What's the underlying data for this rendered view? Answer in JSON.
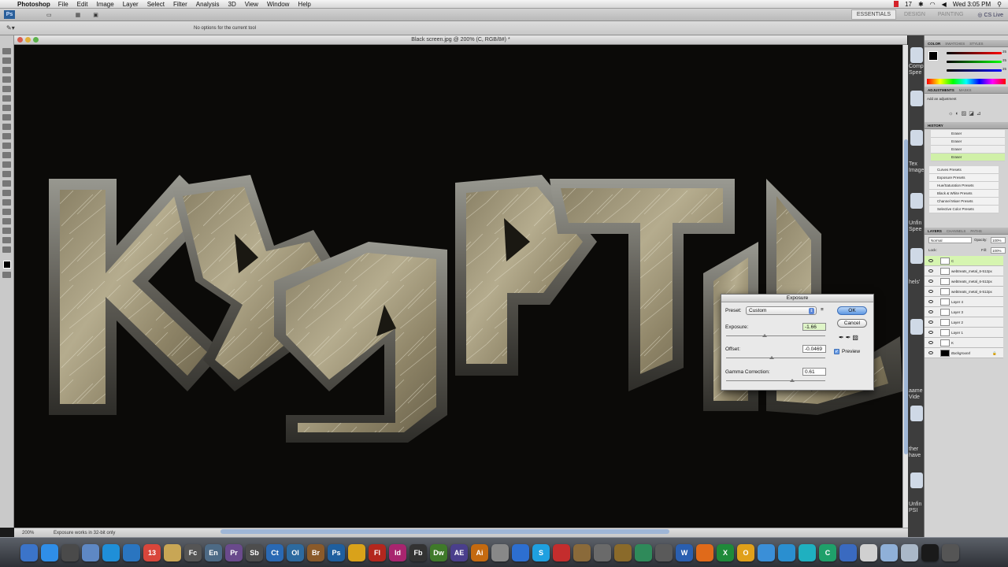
{
  "menubar": {
    "app_name": "Photoshop",
    "items": [
      "File",
      "Edit",
      "Image",
      "Layer",
      "Select",
      "Filter",
      "Analysis",
      "3D",
      "View",
      "Window",
      "Help"
    ],
    "badge_count": "17",
    "clock": "Wed 3:05 PM"
  },
  "appbar": {
    "logo": "Ps",
    "workspaces": [
      "ESSENTIALS",
      "DESIGN",
      "PAINTING"
    ],
    "cs_live": "CS Live"
  },
  "options_bar": {
    "info": "No options for the current tool"
  },
  "document": {
    "title": "Black screen.jpg @ 200% (C, RGB/8#) *",
    "zoom": "200%",
    "status_message": "Exposure works in 32-bit only"
  },
  "icon_strip": {
    "snippets": [
      "Comp Spee",
      "Tex Image",
      "Unfin Spee",
      "hels'",
      "aame Vide",
      "ther have",
      "Unfin PSI"
    ]
  },
  "panels": {
    "top_tabs": [
      "COLOR",
      "SWATCHES",
      "STYLES"
    ],
    "color_values": [
      "25",
      "25",
      "25"
    ],
    "adjust_tabs": [
      "ADJUSTMENTS",
      "MASKS"
    ],
    "adjust_hint": "Add an adjustment",
    "history_tab": "HISTORY",
    "history_items": [
      "Eraser",
      "Eraser",
      "Eraser",
      "Eraser"
    ],
    "adjust_presets": [
      "Curves Presets",
      "Exposure Presets",
      "Hue/Saturation Presets",
      "Black & White Presets",
      "Channel Mixer Presets",
      "Selective Color Presets"
    ],
    "layer_tabs": [
      "LAYERS",
      "CHANNELS",
      "PATHS"
    ],
    "blend_mode": "Normal",
    "opacity_label": "Opacity:",
    "opacity_value": "100%",
    "lock_label": "Lock:",
    "fill_label": "Fill:",
    "fill_value": "100%",
    "layers": [
      "C",
      "webtreats_metal_6-512px",
      "webtreats_metal_6-512px",
      "webtreats_metal_6-512px",
      "Layer 4",
      "Layer 3",
      "Layer 2",
      "Layer 1",
      "K",
      "Background"
    ]
  },
  "dialog": {
    "title": "Exposure",
    "preset_label": "Preset:",
    "preset_value": "Custom",
    "exposure_label": "Exposure:",
    "exposure_value": "-1.66",
    "offset_label": "Offset:",
    "offset_value": "-0.0469",
    "gamma_label": "Gamma Correction:",
    "gamma_value": "0.61",
    "ok_label": "OK",
    "cancel_label": "Cancel",
    "preview_label": "Preview"
  },
  "dock": {
    "apps": [
      {
        "label": "",
        "color": "#3b74c9"
      },
      {
        "label": "",
        "color": "#2f8ee8"
      },
      {
        "label": "",
        "color": "#4a4a4a"
      },
      {
        "label": "",
        "color": "#5e88c4"
      },
      {
        "label": "",
        "color": "#1f8fd8"
      },
      {
        "label": "",
        "color": "#2a75c0"
      },
      {
        "label": "13",
        "color": "#d9463b"
      },
      {
        "label": "",
        "color": "#c8a655"
      },
      {
        "label": "Fc",
        "color": "#555555"
      },
      {
        "label": "En",
        "color": "#4d6a85"
      },
      {
        "label": "Pr",
        "color": "#6a4a8c"
      },
      {
        "label": "Sb",
        "color": "#4d4d4d"
      },
      {
        "label": "Ct",
        "color": "#2a69b3"
      },
      {
        "label": "Ol",
        "color": "#2d6a9f"
      },
      {
        "label": "Br",
        "color": "#8a5a2a"
      },
      {
        "label": "Ps",
        "color": "#1f5f9f"
      },
      {
        "label": "",
        "color": "#d9a21a"
      },
      {
        "label": "Fl",
        "color": "#b3271e"
      },
      {
        "label": "Id",
        "color": "#a8256f"
      },
      {
        "label": "Fb",
        "color": "#333333"
      },
      {
        "label": "Dw",
        "color": "#3f7a2a"
      },
      {
        "label": "AE",
        "color": "#4a3f8c"
      },
      {
        "label": "Ai",
        "color": "#c46a10"
      },
      {
        "label": "",
        "color": "#888888"
      },
      {
        "label": "",
        "color": "#2d6fd0"
      },
      {
        "label": "S",
        "color": "#1fa0e0"
      },
      {
        "label": "",
        "color": "#c42d2d"
      },
      {
        "label": "",
        "color": "#8a6a3a"
      },
      {
        "label": "",
        "color": "#6a6a6a"
      },
      {
        "label": "",
        "color": "#8a6a2a"
      },
      {
        "label": "",
        "color": "#2f8a5a"
      },
      {
        "label": "",
        "color": "#5a5a5a"
      },
      {
        "label": "W",
        "color": "#2a5fb0"
      },
      {
        "label": "",
        "color": "#e06a1a"
      },
      {
        "label": "X",
        "color": "#1f8a3a"
      },
      {
        "label": "O",
        "color": "#e0a01a"
      },
      {
        "label": "",
        "color": "#3a8fd8"
      },
      {
        "label": "",
        "color": "#2a8fd0"
      },
      {
        "label": "",
        "color": "#1fb0c0"
      },
      {
        "label": "C",
        "color": "#1fa06a"
      },
      {
        "label": "",
        "color": "#3a6ac0"
      },
      {
        "label": "",
        "color": "#d0d0d0"
      },
      {
        "label": "",
        "color": "#8fb0d8"
      },
      {
        "label": "",
        "color": "#aab8c8"
      },
      {
        "label": "",
        "color": "#1a1a1a"
      },
      {
        "label": "",
        "color": "#555555"
      }
    ]
  }
}
